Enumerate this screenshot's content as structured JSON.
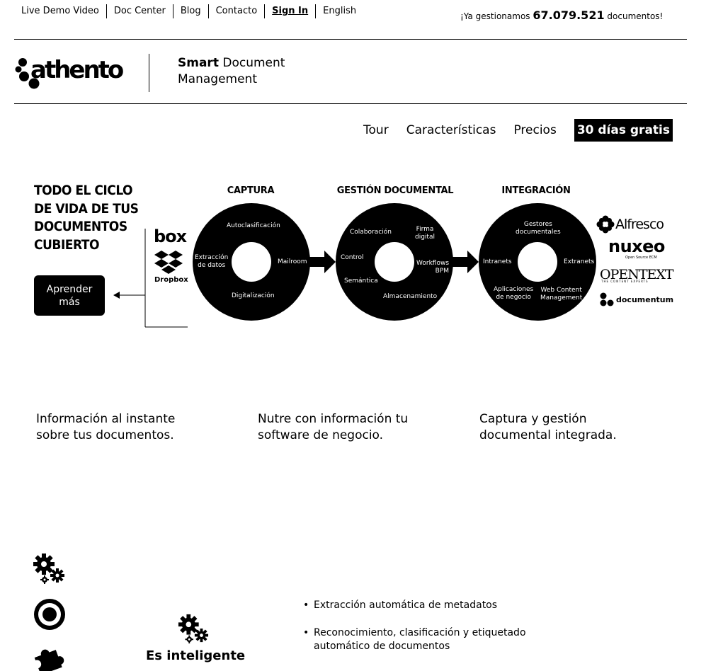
{
  "topnav": {
    "links": [
      "Live Demo Video",
      "Doc Center",
      "Blog",
      "Contacto",
      "Sign In",
      "English"
    ]
  },
  "counter": {
    "prefix": "¡Ya gestionamos",
    "number": "67.079.521",
    "suffix": "documentos!"
  },
  "brand": {
    "logo_text": "athento",
    "tagline_bold": "Smart",
    "tagline_rest1": "Document",
    "tagline_rest2": "Management"
  },
  "mainnav": {
    "items": [
      "Tour",
      "Características",
      "Precios"
    ],
    "cta": "30 días gratis"
  },
  "diagram": {
    "title_lines": [
      "TODO EL CICLO",
      "DE VIDA DE TUS",
      "DOCUMENTOS",
      "CUBIERTO"
    ],
    "learn_button": [
      "Aprender",
      "más"
    ],
    "sources": [
      "box",
      "Dropbox"
    ],
    "captura": {
      "title": "CAPTURA",
      "labels": [
        "Autoclasificación",
        "Extracción",
        "de datos",
        "Mailroom",
        "Digitalización"
      ]
    },
    "gestion": {
      "title": "GESTIÓN DOCUMENTAL",
      "labels": [
        "Colaboración",
        "Firma",
        "digital",
        "Control",
        "Workflows",
        "BPM",
        "Semántica",
        "Almacenamiento"
      ]
    },
    "integracion": {
      "title": "INTEGRACIÓN",
      "labels": [
        "Gestores",
        "documentales",
        "Intranets",
        "Extranets",
        "Aplicaciones",
        "de negocio",
        "Web Content",
        "Management"
      ]
    },
    "partners": {
      "alfresco": "Alfresco",
      "nuxeo": "nuxeo",
      "nuxeo_sub": "Open Source ECM",
      "opentext": "OPENTEXT",
      "opentext_sub": "THE CONTENT EXPERTS",
      "documentum": "documentum"
    }
  },
  "columns": [
    {
      "line1": "Información al instante",
      "line2": "sobre tus documentos."
    },
    {
      "line1": "Nutre con información tu",
      "line2": "software de negocio."
    },
    {
      "line1": "Captura y gestión",
      "line2": "documental integrada."
    }
  ],
  "features": {
    "title": "Es inteligente",
    "bullets": [
      "Extracción automática de metadatos",
      "Reconocimiento, clasificación y etiquetado automático de documentos"
    ]
  }
}
